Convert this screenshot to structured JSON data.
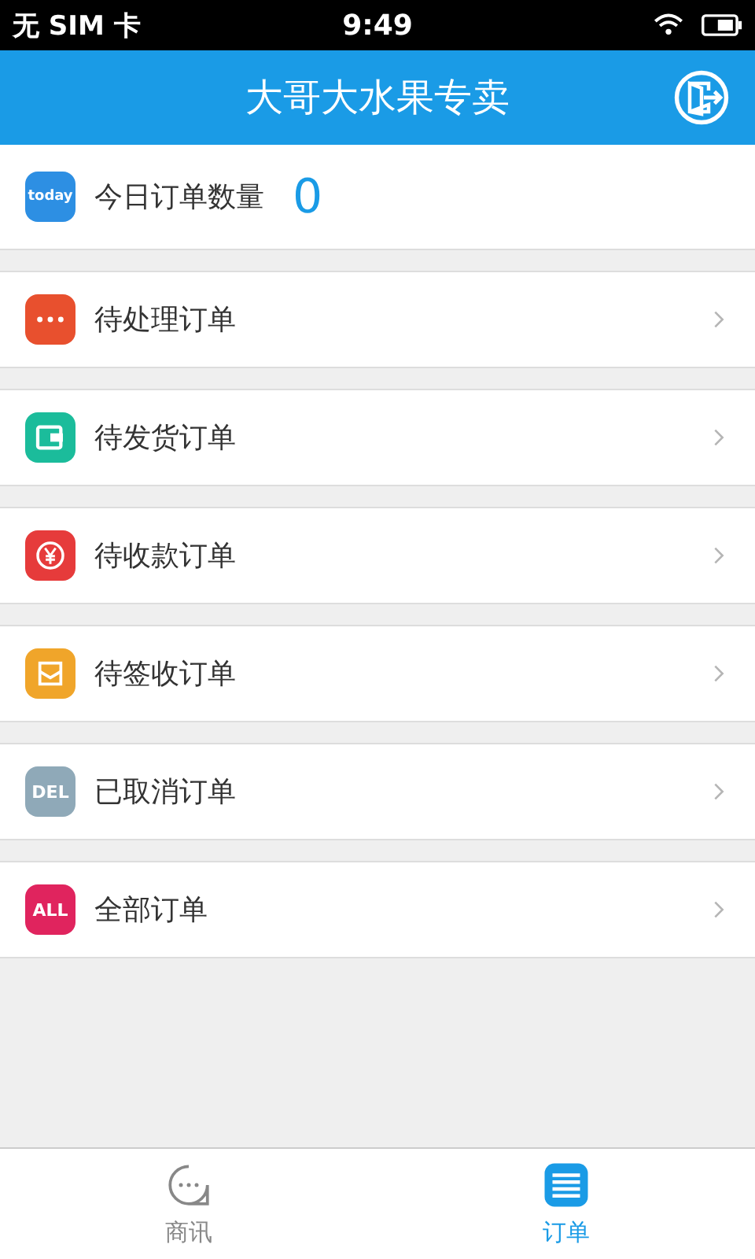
{
  "status_bar": {
    "carrier": "无 SIM 卡",
    "time": "9:49"
  },
  "header": {
    "title": "大哥大水果专卖"
  },
  "today": {
    "badge": "today",
    "label": "今日订单数量",
    "count": "0"
  },
  "orders": [
    {
      "kind": "dots",
      "color": "#e8502e",
      "label": "待处理订单"
    },
    {
      "kind": "wallet",
      "color": "#1bbc9b",
      "label": "待发货订单"
    },
    {
      "kind": "yen",
      "color": "#e63b3b",
      "label": "待收款订单"
    },
    {
      "kind": "envelope",
      "color": "#f0a52a",
      "label": "待签收订单"
    },
    {
      "kind": "text",
      "badge": "DEL",
      "color": "#8fa9b8",
      "label": "已取消订单"
    },
    {
      "kind": "text",
      "badge": "ALL",
      "color": "#e0245e",
      "label": "全部订单"
    }
  ],
  "tabs": [
    {
      "kind": "chat",
      "label": "商讯",
      "selected": false
    },
    {
      "kind": "list",
      "label": "订单",
      "selected": true
    }
  ]
}
